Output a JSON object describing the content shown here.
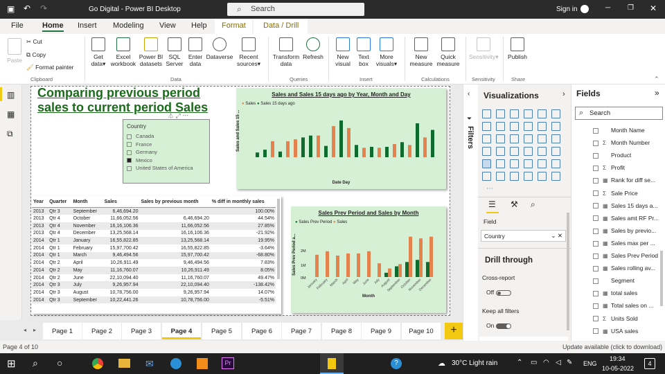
{
  "window": {
    "title": "Go Digital - Power BI Desktop",
    "search": "Search",
    "signin": "Sign in"
  },
  "menu": [
    "File",
    "Home",
    "Insert",
    "Modeling",
    "View",
    "Help",
    "Format",
    "Data / Drill"
  ],
  "ribbon": {
    "clipboard": {
      "paste": "Paste",
      "cut": "Cut",
      "copy": "Copy",
      "format_painter": "Format painter",
      "group": "Clipboard"
    },
    "data": {
      "items": [
        "Get data",
        "Excel workbook",
        "Power BI datasets",
        "SQL Server",
        "Enter data",
        "Dataverse",
        "Recent sources"
      ],
      "group": "Data"
    },
    "queries": {
      "items": [
        "Transform data",
        "Refresh"
      ],
      "group": "Queries"
    },
    "insert": {
      "items": [
        "New visual",
        "Text box",
        "More visuals"
      ],
      "group": "Insert"
    },
    "calculations": {
      "items": [
        "New measure",
        "Quick measure"
      ],
      "group": "Calculations"
    },
    "sensitivity": {
      "items": [
        "Sensitivity"
      ],
      "group": "Sensitivity"
    },
    "share": {
      "items": [
        "Publish"
      ],
      "group": "Share"
    }
  },
  "report": {
    "title": "Comparing previous period sales to current period Sales",
    "slicer": {
      "title": "Country",
      "items": [
        "Canada",
        "France",
        "Germany",
        "Mexico",
        "United States of America"
      ],
      "selected": "Mexico"
    },
    "chart1": {
      "title": "Sales and Sales 15 days ago by Year, Month and Day",
      "legend": [
        "Sales",
        "Sales 15 days ago"
      ],
      "ylabel": "Sales and Sales 15 ...",
      "xlabel": "Date Day"
    },
    "chart2": {
      "title": "Sales Prev Period and Sales by Month",
      "legend": [
        "Sales Prev Period",
        "Sales"
      ],
      "ylabel": "Sales Prev Period a...",
      "xlabel": "Month",
      "yticks": [
        "2M",
        "1M",
        "0M"
      ]
    },
    "table": {
      "headers": [
        "Year",
        "Quarter",
        "Month",
        "Sales",
        "Sales by previous month",
        "% diff in monthly sales"
      ],
      "rows": [
        [
          "2013",
          "Qtr 3",
          "September",
          "6,46,694.20",
          "",
          "100.00%"
        ],
        [
          "2013",
          "Qtr 4",
          "October",
          "11,66,052.56",
          "6,46,694.20",
          "44.54%"
        ],
        [
          "2013",
          "Qtr 4",
          "November",
          "16,16,106.36",
          "11,66,052.56",
          "27.85%"
        ],
        [
          "2013",
          "Qtr 4",
          "December",
          "13,25,568.14",
          "16,16,106.36",
          "-21.92%"
        ],
        [
          "2014",
          "Qtr 1",
          "January",
          "16,55,822.85",
          "13,25,568.14",
          "19.95%"
        ],
        [
          "2014",
          "Qtr 1",
          "February",
          "15,97,700.42",
          "16,55,822.85",
          "-3.64%"
        ],
        [
          "2014",
          "Qtr 1",
          "March",
          "9,46,494.56",
          "15,97,700.42",
          "-68.80%"
        ],
        [
          "2014",
          "Qtr 2",
          "April",
          "10,26,911.49",
          "9,46,494.56",
          "7.83%"
        ],
        [
          "2014",
          "Qtr 2",
          "May",
          "11,16,760.07",
          "10,26,911.49",
          "8.05%"
        ],
        [
          "2014",
          "Qtr 2",
          "June",
          "22,10,094.40",
          "11,16,760.07",
          "49.47%"
        ],
        [
          "2014",
          "Qtr 3",
          "July",
          "9,26,957.94",
          "22,10,094.40",
          "-138.42%"
        ],
        [
          "2014",
          "Qtr 3",
          "August",
          "10,78,756.00",
          "9,26,957.94",
          "14.07%"
        ],
        [
          "2014",
          "Qtr 3",
          "September",
          "10,22,441.26",
          "10,78,756.00",
          "-5.51%"
        ]
      ]
    }
  },
  "pages": [
    "Page 1",
    "Page 2",
    "Page 3",
    "Page 4",
    "Page 5",
    "Page 6",
    "Page 7",
    "Page 8",
    "Page 9",
    "Page 10"
  ],
  "active_page": "Page 4",
  "filters_label": "Filters",
  "visualizations": {
    "title": "Visualizations",
    "field_label": "Field",
    "field_value": "Country",
    "drill_through": "Drill through",
    "cross_report": "Cross-report",
    "cross_report_state": "Off",
    "keep_filters": "Keep all filters",
    "keep_filters_state": "On"
  },
  "fields": {
    "title": "Fields",
    "search": "Search",
    "items": [
      {
        "t": "",
        "n": "Month Name"
      },
      {
        "t": "Σ",
        "n": "Month Number"
      },
      {
        "t": "",
        "n": "Product"
      },
      {
        "t": "Σ",
        "n": "Profit"
      },
      {
        "t": "▦",
        "n": "Rank for diff se..."
      },
      {
        "t": "Σ",
        "n": "Sale Price"
      },
      {
        "t": "▦",
        "n": "Sales 15 days a..."
      },
      {
        "t": "▦",
        "n": "Sales amt RF Pr..."
      },
      {
        "t": "▦",
        "n": "Sales by previo..."
      },
      {
        "t": "▦",
        "n": "Sales max per ..."
      },
      {
        "t": "▦",
        "n": "Sales Prev Period"
      },
      {
        "t": "▦",
        "n": "Sales rolling av..."
      },
      {
        "t": "",
        "n": "Segment"
      },
      {
        "t": "▦",
        "n": "total sales"
      },
      {
        "t": "▦",
        "n": "Total sales on ..."
      },
      {
        "t": "Σ",
        "n": "Units Sold"
      },
      {
        "t": "▦",
        "n": "USA sales"
      }
    ]
  },
  "status": {
    "page": "Page 4 of 10",
    "update": "Update available (click to download)"
  },
  "taskbar": {
    "weather": "30°C  Light rain",
    "lang": "ENG",
    "time": "19:34",
    "date": "10-05-2022",
    "notif": "4"
  }
}
